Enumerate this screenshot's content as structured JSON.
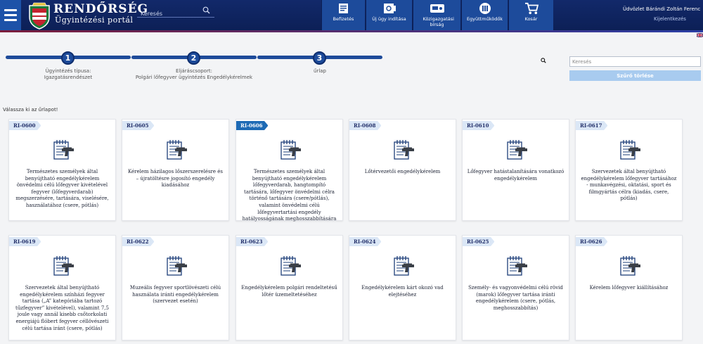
{
  "header": {
    "brand_title": "RENDŐRSÉG",
    "brand_subtitle": "Ügyintézési portál",
    "search_placeholder": "Keresés",
    "nav": [
      {
        "label": "Befizetés",
        "icon": "payment-icon"
      },
      {
        "label": "Új ügy indítása",
        "icon": "new-case-icon"
      },
      {
        "label": "Közigazgatási bírság",
        "icon": "fine-icon"
      },
      {
        "label": "Együttműködők",
        "icon": "partners-icon"
      },
      {
        "label": "Kosár",
        "icon": "cart-icon"
      }
    ],
    "user_greeting": "Üdvözlet Bárándi Zoltán Ferenc",
    "logout": "Kijelentkezés",
    "colors": {
      "topbar": "#12296a",
      "nav_button": "#1d4b9b",
      "accent_line": "#7b1d3c"
    }
  },
  "steps": [
    {
      "number": "1",
      "label_line1": "Ügyintézés típusa:",
      "label_line2": "Igazgatásrendészet"
    },
    {
      "number": "2",
      "label_line1": "Eljáráscsoport:",
      "label_line2": "Polgári lőfegyver ügyintézés Engedélykérelmek"
    },
    {
      "number": "3",
      "label_line1": "űrlap",
      "label_line2": ""
    }
  ],
  "sidebar": {
    "search_placeholder": "Keresés",
    "filter_button": "Szűrő törlése"
  },
  "choose_label": "Válassza ki az űrlapot!",
  "forms": [
    {
      "code": "RI-0600",
      "title": "Természetes személyek által benyújtható engedélykérelem önvédelmi célú lőfegyver kivételével fegyver (lőfegyverdarab) megszerzésére, tartására, viselésére, használatához (csere, pótlás)",
      "active": false
    },
    {
      "code": "RI-0605",
      "title": "Kérelem házilagos lőszerszerelésre és – újratöltésre jogosító engedély kiadásához",
      "active": false
    },
    {
      "code": "RI-0606",
      "title": "Természetes személyek által benyújtható engedélykérelem lőfegyverdarab, hangtompító tartására, lőfegyver önvédelmi célra történő tartására (csere/pótlás), valamint önvédelmi célú lőfegyvertartási engedély hatályosságának meghosszabbítására",
      "active": true
    },
    {
      "code": "RI-0608",
      "title": "Lőtérvezetői engedélykérelem",
      "active": false
    },
    {
      "code": "RI-0610",
      "title": "Lőfegyver hatástalanítására vonatkozó engedélykérelem",
      "active": false
    },
    {
      "code": "RI-0617",
      "title": "Szervezetek által benyújtható engedélykérelem lőfegyver tartásához - munkavégzési, oktatási, sport és filmgyártás célra (kiadás, csere, pótlás)",
      "active": false
    },
    {
      "code": "RI-0619",
      "title": "Szervezetek által benyújtható engedélykérelem színházi fegyver tartása („A” kategóriába tartozó tűzfegyver” kivételével), valamint 7,5 joule vagy annál kisebb csőtorkolati energiájú flóbert fegyver céllövészeti célú tartása iránt (csere, pótlás)",
      "active": false
    },
    {
      "code": "RI-0622",
      "title": "Muzeális fegyver sportlövészeti célú használata iránti engedélykérelem (szervezet esetén)",
      "active": false
    },
    {
      "code": "RI-0623",
      "title": "Engedélykérelem polgári rendeltetésű lőtér üzemeltetéséhez",
      "active": false
    },
    {
      "code": "RI-0624",
      "title": "Engedélykérelem kárt okozó vad elejtéséhez",
      "active": false
    },
    {
      "code": "RI-0625",
      "title": "Személy- és vagyonvédelmi célú rövid (marok) lőfegyver tartása iránti engedélykérelem (csere, pótlás, meghosszabbítás)",
      "active": false
    },
    {
      "code": "RI-0626",
      "title": "Kérelem lőfegyver kiállításához",
      "active": false
    }
  ]
}
